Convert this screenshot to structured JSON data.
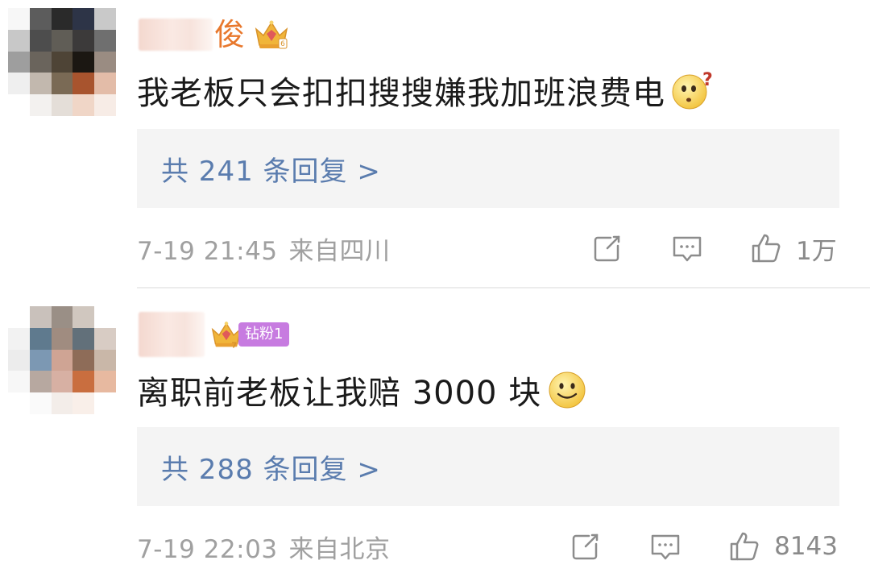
{
  "comments": [
    {
      "username_suffix": "俊",
      "badge_icon": "crown-icon",
      "fan_label": "",
      "text": "我老板只会扣扣搜搜嫌我加班浪费电",
      "emoji": "confused-face-emoji",
      "reply_label": "共 241 条回复 >",
      "time": "7-19 21:45",
      "location": "来自四川",
      "likes": "1万"
    },
    {
      "username_suffix": "",
      "badge_icon": "crown-icon",
      "fan_label": "钻粉1",
      "text": "离职前老板让我赔 3000 块",
      "emoji": "smile-face-emoji",
      "reply_label": "共 288 条回复 >",
      "time": "7-19 22:03",
      "location": "来自北京",
      "likes": "8143"
    }
  ],
  "icons": {
    "forward": "forward-icon",
    "comment": "comment-icon",
    "like": "like-icon"
  },
  "colors": {
    "username": "#e8782d",
    "reply_link": "#5a7cae",
    "meta_text": "#a0a0a0",
    "reply_bg": "#f4f4f4",
    "fan_badge": "#c77be0"
  }
}
